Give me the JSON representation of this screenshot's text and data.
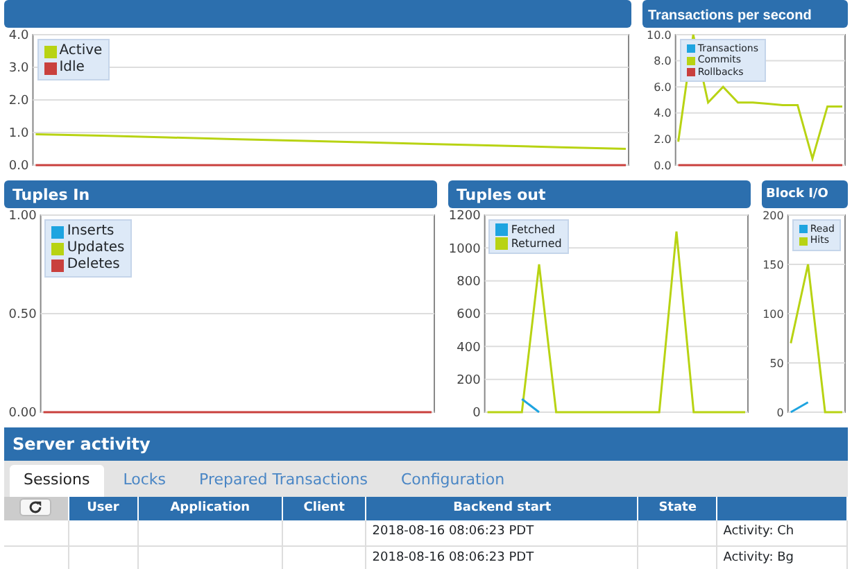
{
  "chart_rows": [
    {
      "panels": [
        {
          "chart_data": {
            "type": "line",
            "grid": true,
            "ylim": [
              0,
              4
            ],
            "yticks": [
              {
                "value": 0,
                "label": "0.0"
              },
              {
                "value": 1,
                "label": "1.0"
              },
              {
                "value": 2,
                "label": "2.0"
              },
              {
                "value": 3,
                "label": "3.0"
              },
              {
                "value": 4,
                "label": "4.0"
              }
            ],
            "series": [
              {
                "name": "Active",
                "color": "#b8d313",
                "values": [
                  0.95,
                  0.9,
                  0.85,
                  0.8,
                  0.75,
                  0.7,
                  0.65,
                  0.6,
                  0.55,
                  0.5
                ]
              },
              {
                "name": "Idle",
                "color": "#c9403d",
                "values": [
                  0,
                  0,
                  0,
                  0,
                  0,
                  0,
                  0,
                  0,
                  0,
                  0
                ]
              }
            ]
          }
        },
        {
          "title": "Transactions per second",
          "chart_data": {
            "type": "line",
            "grid": true,
            "ylim": [
              0,
              10
            ],
            "yticks": [
              {
                "value": 0,
                "label": "0.0"
              },
              {
                "value": 2,
                "label": "2.0"
              },
              {
                "value": 4,
                "label": "4.0"
              },
              {
                "value": 6,
                "label": "6.0"
              },
              {
                "value": 8,
                "label": "8.0"
              },
              {
                "value": 10,
                "label": "10.0"
              }
            ],
            "series": [
              {
                "name": "Transactions",
                "color": "#1ea4e0",
                "values": [
                  null,
                  null,
                  null,
                  null,
                  null,
                  null,
                  null,
                  null,
                  null,
                  null,
                  null,
                  null
                ]
              },
              {
                "name": "Commits",
                "color": "#b8d313",
                "values": [
                  1.8,
                  10,
                  4.8,
                  6,
                  4.8,
                  4.8,
                  4.7,
                  4.6,
                  4.6,
                  0.5,
                  4.5,
                  4.5
                ]
              },
              {
                "name": "Rollbacks",
                "color": "#c9403d",
                "values": [
                  0,
                  0,
                  0,
                  0,
                  0,
                  0,
                  0,
                  0,
                  0,
                  0,
                  0,
                  0
                ]
              }
            ]
          }
        }
      ]
    },
    {
      "panels": [
        {
          "title": "Tuples In",
          "chart_data": {
            "type": "line",
            "grid": true,
            "ylim": [
              0,
              1
            ],
            "yticks": [
              {
                "value": 0,
                "label": "0.00"
              },
              {
                "value": 0.5,
                "label": "0.50"
              },
              {
                "value": 1,
                "label": "1.00"
              }
            ],
            "series": [
              {
                "name": "Inserts",
                "color": "#1ea4e0",
                "values": [
                  null,
                  null,
                  null,
                  null,
                  null,
                  null,
                  null,
                  null
                ]
              },
              {
                "name": "Updates",
                "color": "#b8d313",
                "values": [
                  null,
                  null,
                  null,
                  null,
                  null,
                  null,
                  null,
                  null
                ]
              },
              {
                "name": "Deletes",
                "color": "#c9403d",
                "values": [
                  0,
                  0,
                  0,
                  0,
                  0,
                  0,
                  0,
                  0
                ]
              }
            ]
          }
        },
        {
          "title": "Tuples out",
          "chart_data": {
            "type": "line",
            "grid": true,
            "ylim": [
              0,
              1200
            ],
            "yticks": [
              0,
              200,
              400,
              600,
              800,
              1000,
              1200
            ],
            "series": [
              {
                "name": "Fetched",
                "color": "#1ea4e0",
                "values": [
                  null,
                  null,
                  80,
                  0,
                  null,
                  null,
                  null,
                  null,
                  null,
                  null,
                  null,
                  null,
                  null,
                  null,
                  null,
                  null
                ]
              },
              {
                "name": "Returned",
                "color": "#b8d313",
                "values": [
                  0,
                  0,
                  0,
                  900,
                  0,
                  0,
                  0,
                  0,
                  0,
                  0,
                  0,
                  1100,
                  0,
                  0,
                  0,
                  0
                ]
              }
            ]
          }
        },
        {
          "title": "Block I/O",
          "chart_data": {
            "type": "line",
            "grid": true,
            "ylim": [
              0,
              200
            ],
            "yticks": [
              0,
              50,
              100,
              150,
              200
            ],
            "series": [
              {
                "name": "Read",
                "color": "#1ea4e0",
                "values": [
                  0,
                  10,
                  null,
                  null
                ]
              },
              {
                "name": "Hits",
                "color": "#b8d313",
                "values": [
                  70,
                  150,
                  0,
                  0
                ]
              }
            ]
          }
        }
      ]
    }
  ],
  "server_activity": {
    "title": "Server activity",
    "tabs": [
      {
        "label": "Sessions",
        "selected": true
      },
      {
        "label": "Locks",
        "selected": false
      },
      {
        "label": "Prepared Transactions",
        "selected": false
      },
      {
        "label": "Configuration",
        "selected": false
      }
    ],
    "table": {
      "columns": [
        "User",
        "Application",
        "Client",
        "Backend start",
        "State"
      ],
      "rows": [
        {
          "backend_start": "2018-08-16 08:06:23 PDT",
          "column_6": "Activity: Ch"
        },
        {
          "backend_start": "2018-08-16 08:06:23 PDT",
          "column_6": "Activity: Bg"
        }
      ]
    }
  }
}
